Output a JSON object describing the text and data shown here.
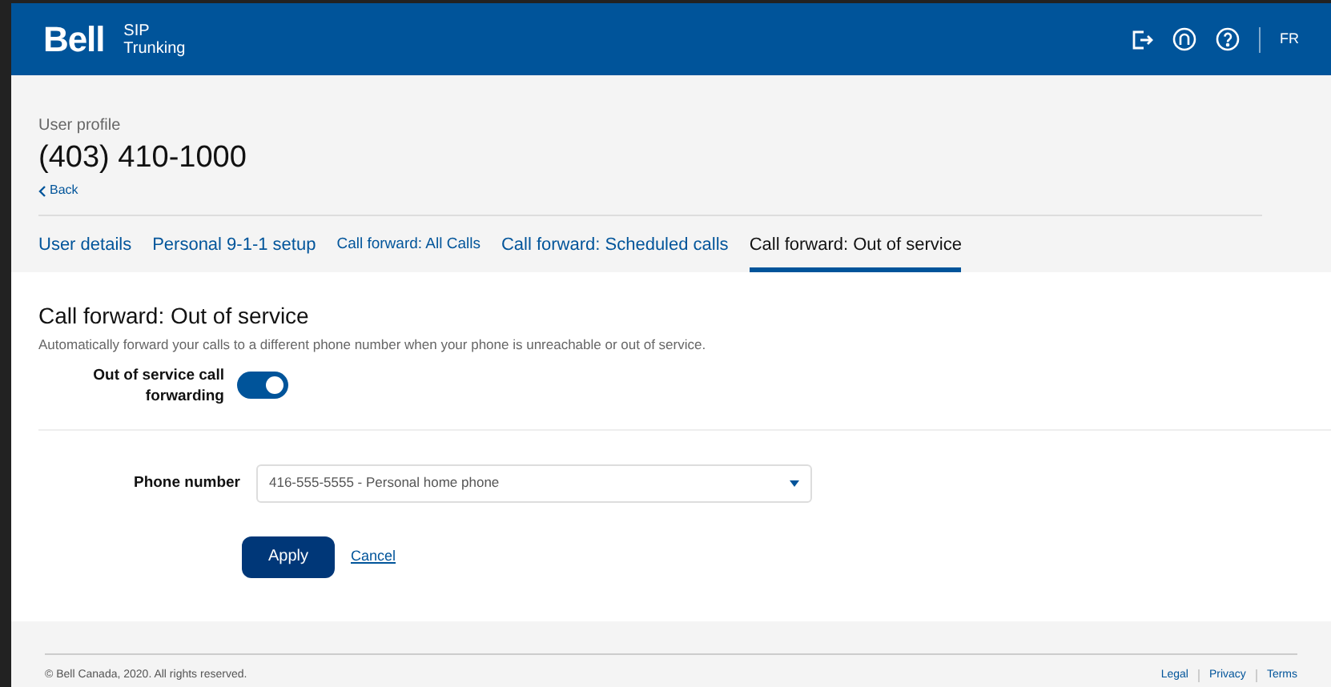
{
  "header": {
    "brand": "Bell",
    "product_line1": "SIP",
    "product_line2": "Trunking",
    "language": "FR"
  },
  "profile": {
    "label": "User profile",
    "number": "(403) 410-1000",
    "back": "Back"
  },
  "tabs": [
    {
      "label": "User details",
      "selected": false
    },
    {
      "label": "Personal 9-1-1 setup",
      "selected": false
    },
    {
      "label": "Call forward: All Calls",
      "selected": false
    },
    {
      "label": "Call forward: Scheduled calls",
      "selected": false
    },
    {
      "label": "Call forward: Out of service",
      "selected": true
    }
  ],
  "section": {
    "title": "Call forward: Out of service",
    "description": "Automatically forward your calls to a different phone number when your phone is unreachable or out of service.",
    "toggle": {
      "label": "Out of service call forwarding",
      "on": true
    },
    "phone_field": {
      "label": "Phone number",
      "value": "416-555-5555 - Personal home phone"
    },
    "buttons": {
      "apply": "Apply",
      "cancel": "Cancel"
    }
  },
  "footer": {
    "copyright": "© Bell Canada, 2020. All rights reserved.",
    "links": [
      "Legal",
      "Privacy",
      "Terms"
    ]
  }
}
